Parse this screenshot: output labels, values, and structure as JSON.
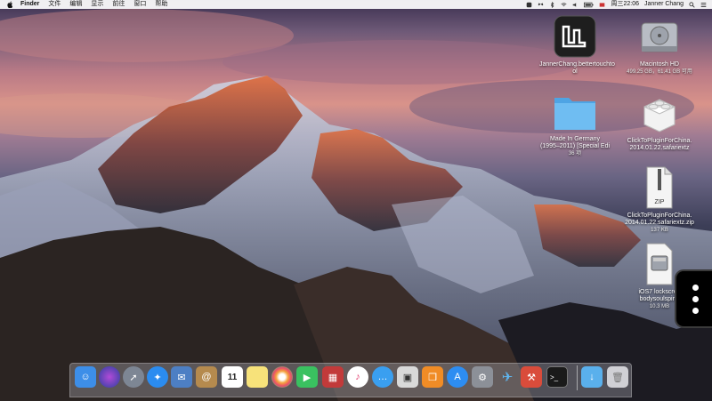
{
  "menubar": {
    "app_name": "Finder",
    "items": [
      "文件",
      "编辑",
      "显示",
      "前往",
      "窗口",
      "帮助"
    ],
    "clock": "周三22:06",
    "username": "Janner Chang"
  },
  "desktop_icons": [
    {
      "name": "JannerChang.bettertouchtool",
      "line1": "JannerChang.bettertouchto",
      "line2": "ol",
      "sub": ""
    },
    {
      "name": "Macintosh HD",
      "line1": "Macintosh HD",
      "line2": "",
      "sub": "499.25 GB，61.41 GB 可用"
    },
    {
      "name": "Made In Germany folder",
      "line1": "Made In Germany",
      "line2": "(1995–2011) [Special Edi",
      "sub": "36 项"
    },
    {
      "name": "ClickToPluginForChina.safariextz",
      "line1": "ClickToPluginForChina.",
      "line2": "2014.01.22.safariextz",
      "sub": ""
    },
    {
      "name": "ClickToPluginForChina zip",
      "line1": "ClickToPluginForChina.",
      "line2": "2014.01.22.safariextz.zip",
      "sub": "137 KB"
    },
    {
      "name": "iOS7 lockscreen",
      "line1": "iOS7 lockscree",
      "line2": "bodysoulspirit.",
      "sub": "10.3 MB"
    }
  ],
  "zip_label": "ZIP",
  "dock": {
    "apps": [
      "Finder",
      "Siri",
      "Launchpad",
      "Safari",
      "Preview",
      "Contacts",
      "Calendar",
      "Notes",
      "Photos",
      "FaceTime",
      "Photo Booth",
      "iTunes",
      "Messages",
      "Photos Viewer",
      "iBooks",
      "App Store",
      "System Preferences",
      "Xcode",
      "Tweetbot",
      "Terminal",
      "Downloads",
      "Trash"
    ],
    "calendar_day": "11"
  },
  "colors": {
    "menubar_bg": "#ededed",
    "folder_blue": "#5ab0ec",
    "btt_bg": "#1e1e1e"
  }
}
